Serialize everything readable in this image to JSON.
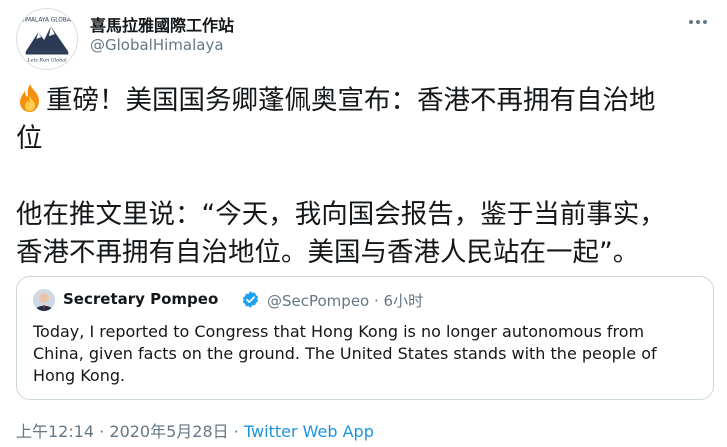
{
  "author": {
    "name": "喜馬拉雅國際工作站",
    "handle": "@GlobalHimalaya",
    "avatar_text_top": "HIMALAYA GLOBAL",
    "avatar_text_bottom": "Lets Run Global"
  },
  "more_icon": "more-horizontal-icon",
  "tweet": {
    "emoji": "fire-icon",
    "line1": "重磅！美国国务卿蓬佩奥宣布：香港不再拥有自治地",
    "line2": "位",
    "line3": "他在推文里说：“今天，我向国会报告，鉴于当前事实，",
    "line4": "香港不再拥有自治地位。美国与香港人民站在一起”。"
  },
  "quoted_tweet": {
    "name": "Secretary Pompeo",
    "verified": true,
    "handle": "@SecPompeo",
    "separator": " · ",
    "time": "6小时",
    "line1": "Today, I reported to Congress that Hong Kong is no longer autonomous from",
    "line2": "China, given facts on the ground. The United States stands with the people of",
    "line3": "Hong Kong."
  },
  "footer": {
    "time": "上午12:14",
    "separator1": " · ",
    "date": "2020年5月28日",
    "separator2": " · ",
    "source": "Twitter Web App"
  },
  "colors": {
    "text": "#14171a",
    "secondary": "#657786",
    "link": "#1b95e0",
    "verified": "#1da1f2",
    "border": "#ccd6dd"
  }
}
